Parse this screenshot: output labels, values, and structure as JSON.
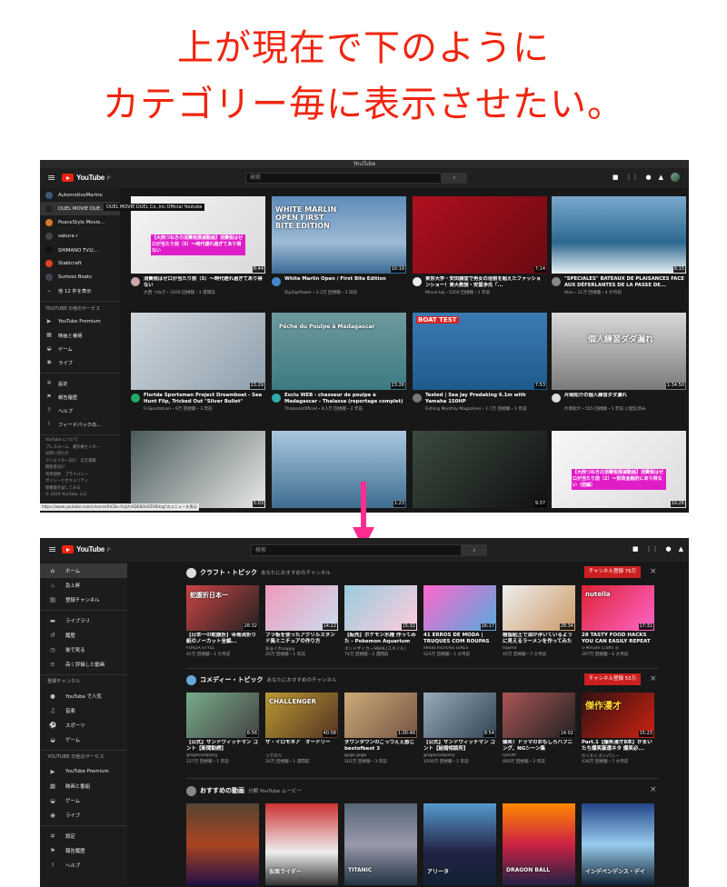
{
  "caption": {
    "line1": "上が現在で下のように",
    "line2": "カテゴリー毎に表示させたい。"
  },
  "top": {
    "window_title": "YouTube",
    "logo_text": "YouTube",
    "logo_sup": "JP",
    "search_placeholder": "検索",
    "search_icon": "magnifier-icon",
    "sidebar_subs": [
      {
        "label": "AutomotiveMarine",
        "color": "#3a5a7a"
      },
      {
        "label": "DUEL MOVIE DUE...",
        "color": "#222"
      },
      {
        "label": "PeaceStyle Movie...",
        "color": "#d47a2a"
      },
      {
        "label": "sakura r",
        "color": "#444"
      },
      {
        "label": "SHIMANO TV公...",
        "color": "#111"
      },
      {
        "label": "Stabicraft",
        "color": "#d42"
      },
      {
        "label": "Surtees Boats",
        "color": "#445"
      },
      {
        "label": "他 12 件を表示",
        "color": "",
        "icon": "chevron-down-icon"
      }
    ],
    "tooltip": "DUEL MOVIE DUEL Co.,Inc.Official Youtube",
    "sidebar_more_header": "YOUTUBE の他のサービス",
    "sidebar_more": [
      {
        "label": "YouTube Premium",
        "icon": "youtube-premium-icon"
      },
      {
        "label": "映画と番組",
        "icon": "film-icon"
      },
      {
        "label": "ゲーム",
        "icon": "gamepad-icon"
      },
      {
        "label": "ライブ",
        "icon": "live-icon"
      }
    ],
    "sidebar_settings": [
      {
        "label": "設定",
        "icon": "gear-icon"
      },
      {
        "label": "報告履歴",
        "icon": "flag-icon"
      },
      {
        "label": "ヘルプ",
        "icon": "help-icon"
      },
      {
        "label": "フィードバックの...",
        "icon": "feedback-icon"
      }
    ],
    "footer": [
      "YouTube について",
      "プレスルーム　著作権センター",
      "お問い合わせ",
      "クリエイター向け　広告掲載",
      "開発者向け",
      "利用規約　プライバシー",
      "ポリシーとセキュリティ",
      "新機能を試してみる",
      "© 2019 YouTube, LLC"
    ],
    "status_url": "https://www.youtube.com/channel/UCBu-OvJVnADE8Gh6ZVEHog\"のメニューを表示",
    "videos": [
      {
        "title": "消費税はゼロが当たり前（5）〜時代遅れ過ぎてあり得ない",
        "meta": "大西 つねき・3100 回視聴・3 週間前",
        "duration": "8:44",
        "thumb": "linear-gradient(135deg,#f4f4f4,#d9d9d9)",
        "label": "【大西つねきの消費税撲滅動画】消費税はゼロが当たり前（5）〜時代遅れ過ぎてあり得ない",
        "av": "#caa"
      },
      {
        "title": "White Marlin Open / First Bite Edition",
        "meta": "ZipZapPower・2.2万 回視聴・3 日前",
        "duration": "10:19",
        "thumb": "linear-gradient(180deg,#5e8cb8,#9dbbd6 60%,#3a6a93)",
        "label": "WHITE MARLIN OPEN FIRST BITE EDITION",
        "av": "#48c"
      },
      {
        "title": "東京大学・安田講堂で男女の垣根を超えたファッションショー！東大教授・安冨歩氏「...",
        "meta": "Movie Iwj・5200 回視聴・1 年前",
        "duration": "7:14",
        "thumb": "linear-gradient(135deg,#b01020,#6a0a12)",
        "label": "",
        "av": "#eee"
      },
      {
        "title": "\"SPÉCIALES\" BATEAUX DE PLAISANCES FACE AUX DÉFERLANTES DE LA PASSE DE...",
        "meta": "Alex・21万 回視聴・4 か月前",
        "duration": "8:15",
        "thumb": "linear-gradient(180deg,#7aa8cc,#2d6890 60%,#e8f0f5)",
        "label": "",
        "av": "#888"
      },
      {
        "title": "Florida Sportsman Project Dreamboat - Sea Hunt Flip, Tricked Out \"Silver Bullet\"",
        "meta": "FLSportsman・9万 回視聴・3 年前",
        "duration": "23:29",
        "thumb": "linear-gradient(135deg,#cfd6dc,#8fa0ad)",
        "label": "",
        "av": "#2a6"
      },
      {
        "title": "Exclu WEB - chasseur de poulpe à Madagascar - Thalassa (reportage complet)",
        "meta": "ThalassaOfficiel・9.1万 回視聴・2 年前",
        "duration": "23:26",
        "thumb": "linear-gradient(180deg,#6e9a9e,#3c7a80)",
        "label": "Pêche du Poulpe à Madagascar",
        "av": "#3aa"
      },
      {
        "title": "Tested | Sea Jay Predaking 6.1m with Yamaha 150HP",
        "meta": "Fishing Monthly Magazines・1.7万 回視聴・1 年前",
        "duration": "7:53",
        "thumb": "linear-gradient(180deg,#3b7bb5,#1e5a8d)",
        "label": "BOAT TEST",
        "av": "#777"
      },
      {
        "title": "片岡松介の個人練習ダダ漏れ",
        "meta": "片岡松介・555 回視聴・1 年前 に配信済み",
        "duration": "1:34:50",
        "thumb": "linear-gradient(180deg,#d9d9d9,#7a7a7a)",
        "label": "個人練習ダダ漏れ",
        "av": "#ddd"
      },
      {
        "title": "",
        "meta": "",
        "duration": "5:03",
        "thumb": "linear-gradient(135deg,#4a5a5a,#e8e8e8)",
        "label": "",
        "av": ""
      },
      {
        "title": "",
        "meta": "",
        "duration": "1:23",
        "thumb": "linear-gradient(180deg,#a9c7e0,#3e6d90)",
        "label": "",
        "av": ""
      },
      {
        "title": "",
        "meta": "",
        "duration": "9:37",
        "thumb": "linear-gradient(135deg,#3a4a3e,#111)",
        "label": "",
        "av": ""
      },
      {
        "title": "",
        "meta": "",
        "duration": "10:26",
        "thumb": "linear-gradient(135deg,#f7f7f7,#ddd)",
        "label": "【大西つねきの消費税撲滅動画】消費税はゼロが当たり前（2）〜財政金融的にあり得ない（前編）",
        "av": ""
      }
    ]
  },
  "arrow_color": "#ff2d90",
  "bottom": {
    "logo_text": "YouTube",
    "logo_sup": "JP",
    "search_placeholder": "検索",
    "sidebar": [
      {
        "label": "ホーム",
        "icon": "home-icon",
        "active": true
      },
      {
        "label": "急上昇",
        "icon": "flame-icon"
      },
      {
        "label": "登録チャンネル",
        "icon": "subscriptions-icon"
      },
      {
        "sep": true
      },
      {
        "label": "ライブラリ",
        "icon": "folder-icon"
      },
      {
        "label": "履歴",
        "icon": "history-icon"
      },
      {
        "label": "後で見る",
        "icon": "clock-icon"
      },
      {
        "label": "高く評価した動画",
        "icon": "list-icon"
      },
      {
        "sep": true
      },
      {
        "header": "登録チャンネル"
      },
      {
        "label": "YouTube で人気",
        "icon": "popular-icon"
      },
      {
        "label": "音楽",
        "icon": "music-icon"
      },
      {
        "label": "スポーツ",
        "icon": "sports-icon"
      },
      {
        "label": "ゲーム",
        "icon": "gamepad-icon"
      },
      {
        "sep": true
      },
      {
        "header": "YOUTUBE の他のサービス"
      },
      {
        "label": "YouTube Premium",
        "icon": "youtube-premium-icon"
      },
      {
        "label": "映画と番組",
        "icon": "film-icon"
      },
      {
        "label": "ゲーム",
        "icon": "gamepad-icon"
      },
      {
        "label": "ライブ",
        "icon": "live-icon"
      },
      {
        "sep": true
      },
      {
        "label": "設定",
        "icon": "gear-icon"
      },
      {
        "label": "報告履歴",
        "icon": "flag-icon"
      },
      {
        "label": "ヘルプ",
        "icon": "help-icon"
      }
    ],
    "shelves": [
      {
        "title": "クラフト・トピック",
        "subtitle": "あなたにおすすめのチャンネル",
        "subscribe": "チャンネル登録 76万",
        "icon_color": "#ddd",
        "videos": [
          {
            "title": "【日本一の蛇腹折】寺島流折り紙のノーカット全編...",
            "m1": "FORZA STYLE",
            "m2": "41万 回視聴・1 か月前",
            "d": "28:32",
            "bg": "linear-gradient(135deg,#c44,#222)",
            "lbl": "蛇腹折日本一"
          },
          {
            "title": "プラ板を使ったアクリルスタンド風ミニチュアの作り方",
            "m1": "気まぐれnappy",
            "m2": "20万 回視聴・1 年前",
            "d": "14:22",
            "bg": "linear-gradient(135deg,#e9b,#cde)",
            "lbl": ""
          },
          {
            "title": "【転売】ポケモン水槽 作ってみた - Pokemon Aquarium",
            "m1": "ネンドザイカーSNAIL[スネイル]",
            "m2": "74万 回視聴・2 週間前",
            "d": "15:32",
            "bg": "linear-gradient(135deg,#9cd,#fcd)",
            "lbl": ""
          },
          {
            "title": "41 ERROS DE MODA | TRUQUES COM ROUPAS E...",
            "m1": "Ideias Incríveis GIRLS",
            "m2": "524万 回視聴・1 か月前",
            "d": "16:17",
            "bg": "linear-gradient(135deg,#f6c,#5ad)",
            "lbl": ""
          },
          {
            "title": "樹脂粘土で油が浮いているように見えるラーメンを作ってみた",
            "m1": "hajime",
            "m2": "45万 回視聴・7 か月前",
            "d": "28:34",
            "bg": "linear-gradient(135deg,#eee,#c96)",
            "lbl": ""
          },
          {
            "title": "28 TASTY FOOD HACKS YOU CAN EASILY REPEAT",
            "m1": "5-Minute Crafts ◎",
            "m2": "297万 回視聴・6 か月前",
            "d": "17:31",
            "bg": "linear-gradient(135deg,#d23,#f6c)",
            "lbl": "nutella"
          }
        ]
      },
      {
        "title": "コメディー・トピック",
        "subtitle": "あなたにおすすめのチャンネル",
        "subscribe": "チャンネル登録 55万",
        "icon_color": "#6ad",
        "videos": [
          {
            "title": "【公式】サンドウィッチマン コント【新聞勧誘】",
            "m1": "grapecompany",
            "m2": "227万 回視聴・1 年前",
            "d": "6:56",
            "bg": "linear-gradient(135deg,#7a8,#444)",
            "lbl": ""
          },
          {
            "title": "ザ・イロモネア　オードリー",
            "m1": "つでのり",
            "m2": "20万 回視聴・1 週間前",
            "d": "40:58",
            "bg": "linear-gradient(135deg,#b93,#532)",
            "lbl": "CHALLENGER"
          },
          {
            "title": "ダウンタウンのごっつええ感じ bestofbest 3",
            "m1": "gogo gogo",
            "m2": "102万 回視聴・3 年前",
            "d": "1:00:46",
            "bg": "linear-gradient(135deg,#ca7,#754)",
            "lbl": ""
          },
          {
            "title": "【公式】サンドウィッチマン コント【結婚相談所】",
            "m1": "grapecompany",
            "m2": "1500万 回視聴・1 年前",
            "d": "8:54",
            "bg": "linear-gradient(135deg,#9ab,#345)",
            "lbl": ""
          },
          {
            "title": "爆笑！ドラマのおもしろハプニング、NGシーン集",
            "m1": "QOOIP",
            "m2": "469万 回視聴・2 年前",
            "d": "14:02",
            "bg": "linear-gradient(135deg,#a55,#222)",
            "lbl": ""
          },
          {
            "title": "Part.1【爆笑漫才8本】かまいたち爆笑厳選ネタ 爆笑必...",
            "m1": "わくわくカンパニー",
            "m2": "436万 回視聴・7 か月前",
            "d": "15:23",
            "bg": "linear-gradient(135deg,#311,#c21)",
            "lbl": "傑作漫才"
          }
        ]
      },
      {
        "title": "おすすめの動画",
        "subtitle": "分類 YouTube ムービー",
        "icon_color": "#888",
        "posters": [
          {
            "bg": "linear-gradient(180deg,#543,#a42 50%,#214)",
            "lbl": ""
          },
          {
            "bg": "linear-gradient(180deg,#c33,#eee 60%,#333)",
            "lbl": "仮面ライダー"
          },
          {
            "bg": "linear-gradient(180deg,#567,#99a 50%,#234)",
            "lbl": "TITANIC"
          },
          {
            "bg": "linear-gradient(180deg,#59c,#224 60%,#123)",
            "lbl": "アリータ"
          },
          {
            "bg": "linear-gradient(180deg,#f80,#c24 50%,#224)",
            "lbl": "DRAGON BALL"
          },
          {
            "bg": "linear-gradient(180deg,#248,#9ce 50%,#123)",
            "lbl": "インデペンデンス・デイ"
          }
        ]
      }
    ]
  }
}
